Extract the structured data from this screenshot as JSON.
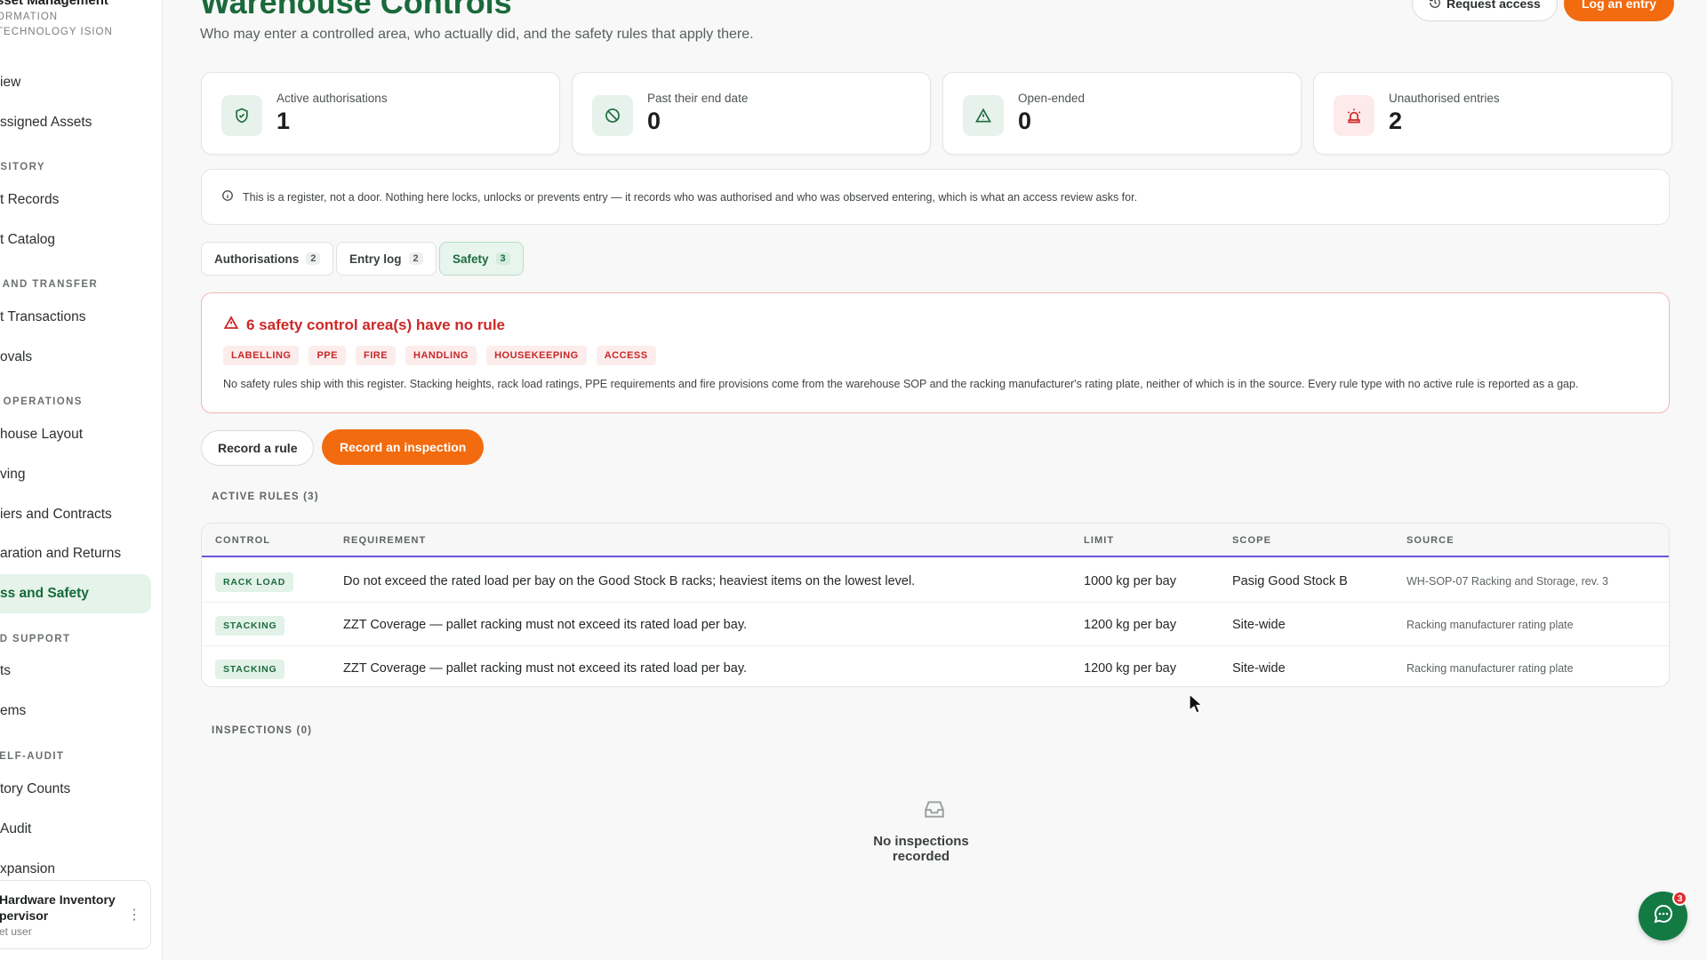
{
  "sidebar": {
    "brand_title": "sset Management",
    "brand_subtitle": "ORMATION TECHNOLOGY ISION",
    "items": [
      {
        "label": "iew"
      },
      {
        "label": "ssigned Assets"
      },
      {
        "section": "OSITORY"
      },
      {
        "label": "t Records"
      },
      {
        "label": "t Catalog"
      },
      {
        "section": "T AND TRANSFER"
      },
      {
        "label": "t Transactions"
      },
      {
        "label": "ovals"
      },
      {
        "section": "E OPERATIONS"
      },
      {
        "label": "house Layout"
      },
      {
        "label": "ving"
      },
      {
        "label": "iers and Contracts"
      },
      {
        "label": "aration and Returns"
      },
      {
        "label": "ss and Safety",
        "active": true
      },
      {
        "section": "ND SUPPORT"
      },
      {
        "label": "ts"
      },
      {
        "label": "ems"
      },
      {
        "section": "SELF-AUDIT"
      },
      {
        "label": "tory Counts"
      },
      {
        "label": "Audit"
      },
      {
        "label": "xpansion"
      }
    ],
    "user": {
      "name": "Hardware Inventory pervisor",
      "role": "et user",
      "menu_icon": "more-vertical-icon"
    }
  },
  "header": {
    "title": "Warehouse Controls",
    "subtitle": "Who may enter a controlled area, who actually did, and the safety rules that apply there.",
    "request_access_label": "Request access",
    "log_entry_label": "Log an entry"
  },
  "stats": [
    {
      "label": "Active authorisations",
      "value": "1",
      "icon": "shield-check-icon"
    },
    {
      "label": "Past their end date",
      "value": "0",
      "icon": "ban-icon"
    },
    {
      "label": "Open-ended",
      "value": "0",
      "icon": "warning-icon"
    },
    {
      "label": "Unauthorised entries",
      "value": "2",
      "icon": "siren-icon"
    }
  ],
  "notice": "This is a register, not a door. Nothing here locks, unlocks or prevents entry — it records who was authorised and who was observed entering, which is what an access review asks for.",
  "tabs": [
    {
      "label": "Authorisations",
      "count": "2"
    },
    {
      "label": "Entry log",
      "count": "2"
    },
    {
      "label": "Safety",
      "count": "3",
      "active": true
    }
  ],
  "alert": {
    "title": "6 safety control area(s) have no rule",
    "chips": [
      "LABELLING",
      "PPE",
      "FIRE",
      "HANDLING",
      "HOUSEKEEPING",
      "ACCESS"
    ],
    "body": "No safety rules ship with this register. Stacking heights, rack load ratings, PPE requirements and fire provisions come from the warehouse SOP and the racking manufacturer's rating plate, neither of which is in the source. Every rule type with no active rule is reported as a gap."
  },
  "actions": {
    "record_rule_label": "Record a rule",
    "record_inspection_label": "Record an inspection"
  },
  "rules": {
    "section_label": "ACTIVE RULES (3)",
    "columns": [
      "CONTROL",
      "REQUIREMENT",
      "LIMIT",
      "SCOPE",
      "SOURCE"
    ],
    "rows": [
      {
        "control": "RACK LOAD",
        "requirement": "Do not exceed the rated load per bay on the Good Stock B racks; heaviest items on the lowest level.",
        "limit": "1000 kg per bay",
        "scope": "Pasig Good Stock B",
        "source": "WH-SOP-07 Racking and Storage, rev. 3"
      },
      {
        "control": "STACKING",
        "requirement": "ZZT Coverage — pallet racking must not exceed its rated load per bay.",
        "limit": "1200 kg per bay",
        "scope": "Site-wide",
        "source": "Racking manufacturer rating plate"
      },
      {
        "control": "STACKING",
        "requirement": "ZZT Coverage — pallet racking must not exceed its rated load per bay.",
        "limit": "1200 kg per bay",
        "scope": "Site-wide",
        "source": "Racking manufacturer rating plate"
      }
    ]
  },
  "inspections": {
    "section_label": "INSPECTIONS (0)",
    "empty_text": "No inspections recorded",
    "empty_icon": "inbox-icon"
  },
  "chat": {
    "badge": "3",
    "icon": "chat-icon"
  },
  "colors": {
    "brand_green": "#1a6a3b",
    "accent_orange": "#f26b0f",
    "danger_red": "#cf2727",
    "table_accent": "#6e54d9"
  }
}
